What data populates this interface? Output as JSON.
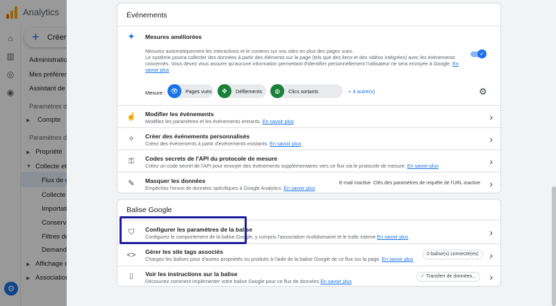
{
  "app": {
    "title": "Analytics"
  },
  "nav": {
    "create_label": "Créer",
    "items": [
      "Administration",
      "Mes préférences",
      "Assistant de configuration"
    ],
    "section_account": "Paramètres du compte",
    "account_item": "Compte",
    "section_property": "Paramètres de la propriété",
    "property_item": "Propriété",
    "collect_item": "Collecte et modification des données",
    "collect_children": [
      "Flux de données",
      "Collecte des données",
      "Importation des données",
      "Conservation des données",
      "Filtres de données",
      "Demandes de suppression"
    ],
    "display_item": "Affichage des données",
    "assoc_item": "Associations de produits"
  },
  "events_card": {
    "title": "Événements",
    "enhanced": {
      "title": "Mesures améliorées",
      "desc_line1": "Mesurez automatiquement les interactions et le contenu sur vos sites en plus des pages vues.",
      "desc_line2": "Le système pourra collecter des données à partir des éléments sur la page (tels que des liens et des vidéos intégrées) avec les événements concernés. Vous devez vous assurer qu'aucune information permettant d'identifier personnellement l'utilisateur ne sera envoyée à Google.",
      "learn_more": "En savoir plus",
      "toggle_on": true,
      "measure_label": "Mesure :",
      "chips": [
        {
          "label": "Pages vues",
          "icon": "eye-icon",
          "color": "#1a73e8"
        },
        {
          "label": "Défilements",
          "icon": "scroll-icon",
          "color": "#188038"
        },
        {
          "label": "Clics sortants",
          "icon": "mouse-icon",
          "color": "#188038"
        }
      ],
      "more": "+ 4 autre(s)"
    },
    "rows": [
      {
        "title": "Modifier les événements",
        "desc": "Modifiez les paramètres et les événements entrants.",
        "link": "En savoir plus",
        "icon": "touch-icon"
      },
      {
        "title": "Créer des événements personnalisés",
        "desc": "Créez des événements à partir d'événements existants.",
        "link": "En savoir plus",
        "icon": "sparkle-click-icon"
      },
      {
        "title": "Codes secrets de l'API du protocole de mesure",
        "desc": "Créez un code secret de l'API pour envoyer des événements supplémentaires vers ce flux via le protocole de mesure.",
        "link": "En savoir plus",
        "icon": "key-icon"
      },
      {
        "title": "Masquer les données",
        "desc": "Empêchez l'envoi de données spécifiques à Google Analytics.",
        "link": "En savoir plus",
        "icon": "redact-icon",
        "status1": "E-mail inactive",
        "status2": "Clés des paramètres de requête de l'URL inactive"
      }
    ]
  },
  "tag_card": {
    "title": "Balise Google",
    "rows": [
      {
        "title": "Configurer les paramètres de la balise",
        "desc": "Configurez le comportement de la balise Google, y compris l'association multidomaine et le trafic interne",
        "link": "En savoir plus",
        "icon": "tag-settings-icon"
      },
      {
        "title": "Gérer les site tags associés",
        "desc": "Chargez les balises pour d'autres propriétés ou produits à l'aide de la balise Google de ce flux sur la page.",
        "link": "En savoir plus",
        "icon": "code-icon",
        "badge": "0 balise(s) connecté(es)"
      },
      {
        "title": "Voir les instructions sur la balise",
        "desc": "Découvrez comment implémenter votre balise Google pour ce flux de données",
        "link": "En savoir plus",
        "icon": "code-box-icon",
        "badge": "Transfert de données..."
      }
    ]
  }
}
